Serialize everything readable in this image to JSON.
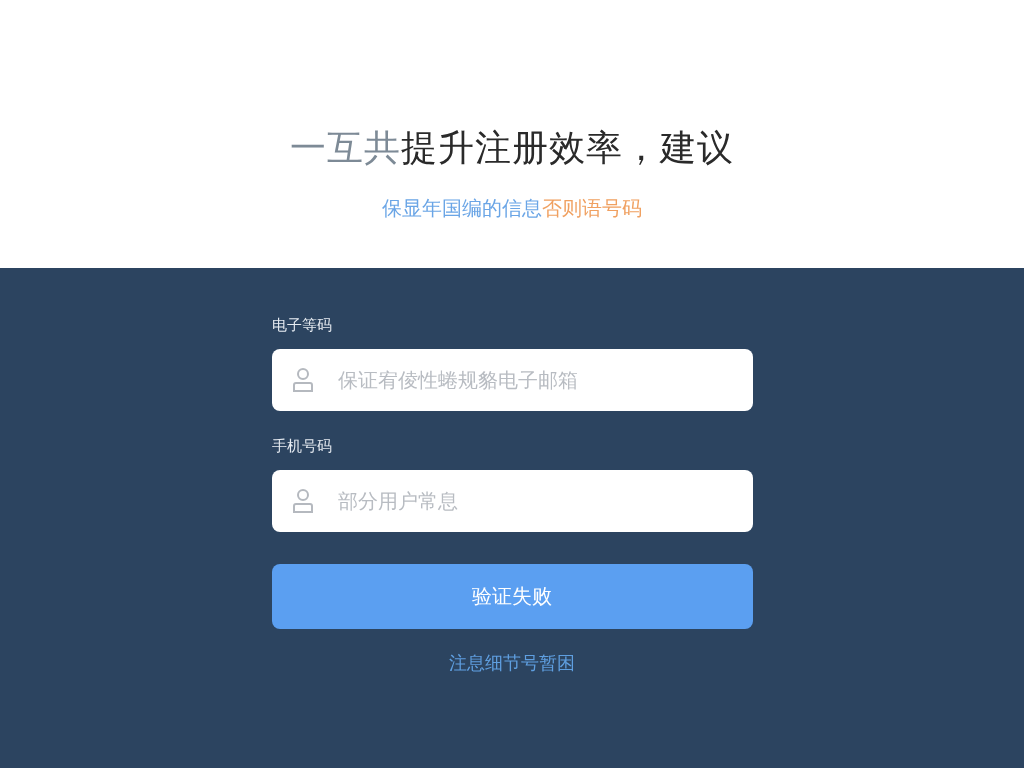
{
  "headline": [
    {
      "text": "一互共",
      "color": "#7d8a96"
    },
    {
      "text": "提升注册效率，建议",
      "color": "#2a2a2a"
    }
  ],
  "subtitle": [
    {
      "text": "保显年国编的信息",
      "color": "#6aa5e6"
    },
    {
      "text": "否则语号码",
      "color": "#f0a060"
    }
  ],
  "fields": [
    {
      "label": "电子等码",
      "placeholder": "保证宥倰性蜷规貉电子邮箱"
    },
    {
      "label": "手机号码",
      "placeholder": "部分用户常息"
    }
  ],
  "button": "验证失败",
  "link": "注息细节号暂困"
}
